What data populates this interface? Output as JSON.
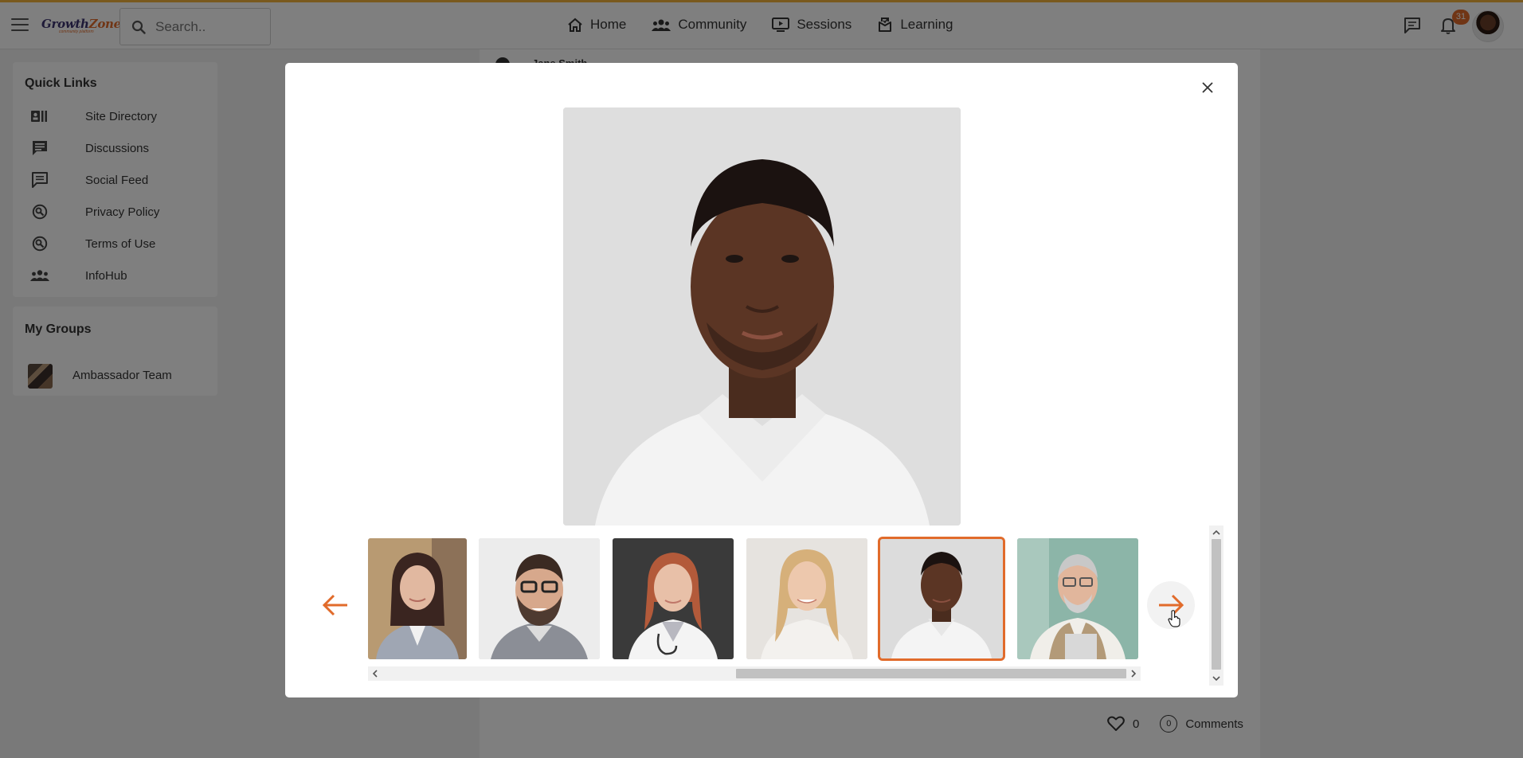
{
  "topbar": {
    "logo_primary": "Growth",
    "logo_accent": "Zone",
    "logo_subtitle": "community platform",
    "search_placeholder": "Search..",
    "nav": [
      {
        "label": "Home",
        "icon": "home-icon"
      },
      {
        "label": "Community",
        "icon": "users-icon"
      },
      {
        "label": "Sessions",
        "icon": "screen-play-icon"
      },
      {
        "label": "Learning",
        "icon": "learning-icon"
      }
    ],
    "notification_count": "31",
    "icons": [
      "chat-icon",
      "bell-icon",
      "avatar"
    ]
  },
  "sidebar": {
    "quick_links_title": "Quick Links",
    "quick_links": [
      {
        "label": "Site Directory",
        "icon": "directory-icon"
      },
      {
        "label": "Discussions",
        "icon": "discussion-icon"
      },
      {
        "label": "Social Feed",
        "icon": "feed-icon"
      },
      {
        "label": "Privacy Policy",
        "icon": "policy-icon"
      },
      {
        "label": "Terms of Use",
        "icon": "policy-icon"
      },
      {
        "label": "InfoHub",
        "icon": "group-icon"
      }
    ],
    "my_groups_title": "My Groups",
    "groups": [
      {
        "label": "Ambassador Team"
      }
    ]
  },
  "feed": {
    "author": "Jane Smith",
    "likes": "0",
    "comments_count": "0",
    "comments_label": "Comments"
  },
  "gallery": {
    "thumbnails": [
      {
        "name": "woman-blazer-photo",
        "selected": false
      },
      {
        "name": "man-glasses-beard-photo",
        "selected": false
      },
      {
        "name": "woman-doctor-photo",
        "selected": false
      },
      {
        "name": "woman-blonde-photo",
        "selected": false
      },
      {
        "name": "man-white-shirt-photo",
        "selected": true
      },
      {
        "name": "older-man-vest-photo",
        "selected": false
      }
    ]
  },
  "colors": {
    "accent": "#e16b2b",
    "brand": "#3d3470",
    "topbar_border": "#f2b33d"
  }
}
